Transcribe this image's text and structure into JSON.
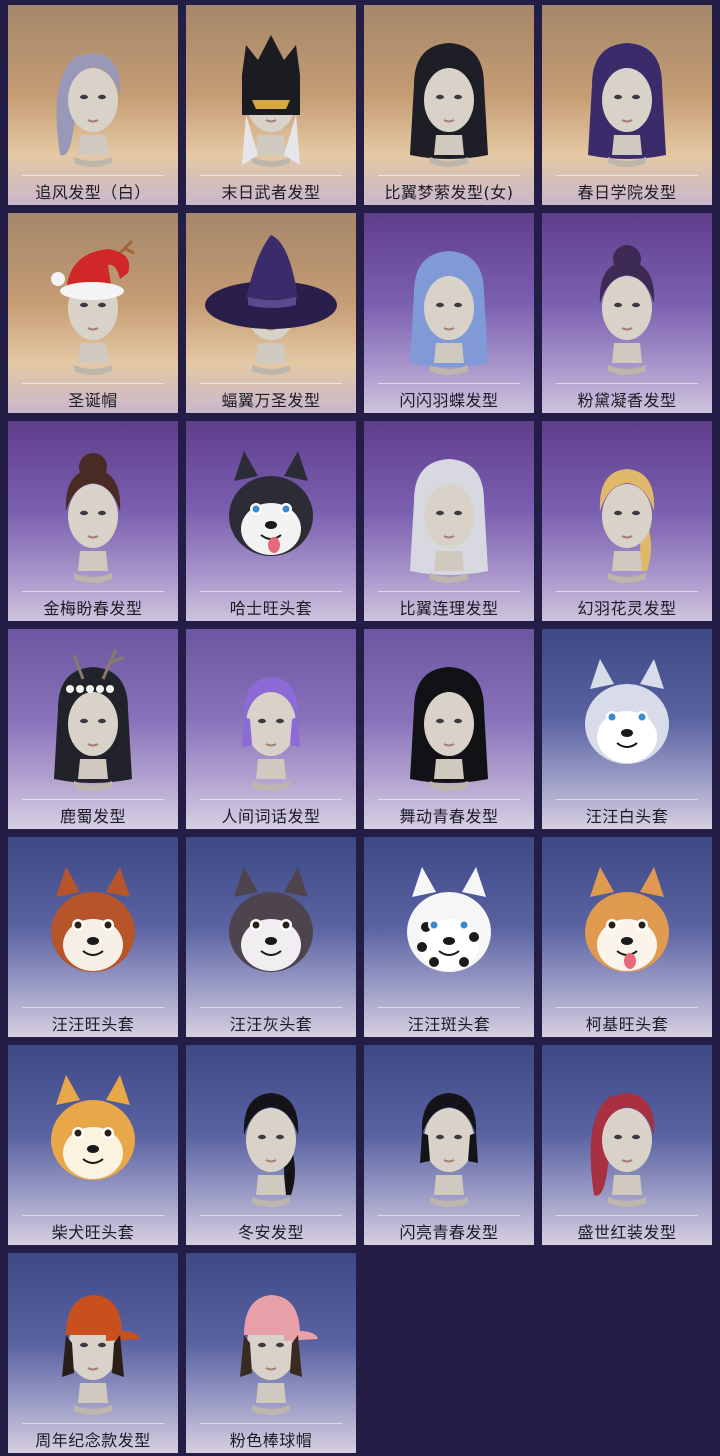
{
  "items": [
    {
      "label": "追风发型（白）",
      "icon": "silver-ponytail-hair-icon",
      "theme": "gold",
      "hair": "#9a98b8",
      "kind": "ponytail"
    },
    {
      "label": "末日武者发型",
      "icon": "armored-helmet-hair-icon",
      "theme": "gold",
      "hair": "#1b1b22",
      "kind": "helmet"
    },
    {
      "label": "比翼梦萦发型(女)",
      "icon": "black-long-hair-icon",
      "theme": "gold",
      "hair": "#1e1e26",
      "kind": "long"
    },
    {
      "label": "春日学院发型",
      "icon": "purple-long-hair-icon",
      "theme": "gold",
      "hair": "#3a2c6a",
      "kind": "long"
    },
    {
      "label": "圣诞帽",
      "icon": "santa-hat-icon",
      "theme": "gold",
      "hair": "#8a6a4a",
      "kind": "santa"
    },
    {
      "label": "蝠翼万圣发型",
      "icon": "witch-hat-icon",
      "theme": "gold",
      "hair": "#2a1f4a",
      "kind": "witch"
    },
    {
      "label": "闪闪羽蝶发型",
      "icon": "blue-wavy-hair-icon",
      "theme": "purple",
      "hair": "#7f9ad6",
      "kind": "long"
    },
    {
      "label": "粉黛凝香发型",
      "icon": "purple-bun-hair-icon",
      "theme": "purple",
      "hair": "#3d2a55",
      "kind": "bun"
    },
    {
      "label": "金梅盼春发型",
      "icon": "brown-bun-hair-icon",
      "theme": "purple",
      "hair": "#4a2a24",
      "kind": "bun"
    },
    {
      "label": "哈士旺头套",
      "icon": "husky-mask-icon",
      "theme": "purple",
      "hair": "#2a2a34",
      "kind": "dog",
      "dog": "husky"
    },
    {
      "label": "比翼连理发型",
      "icon": "silver-feather-hair-icon",
      "theme": "purple",
      "hair": "#d8d8e0",
      "kind": "long"
    },
    {
      "label": "幻羽花灵发型",
      "icon": "blonde-braid-hair-icon",
      "theme": "purple",
      "hair": "#e0b86a",
      "kind": "braid"
    },
    {
      "label": "鹿蜀发型",
      "icon": "deer-antler-hair-icon",
      "theme": "lav",
      "hair": "#22222a",
      "kind": "antler"
    },
    {
      "label": "人间词话发型",
      "icon": "violet-bob-hair-icon",
      "theme": "lav",
      "hair": "#8c6ad8",
      "kind": "bob"
    },
    {
      "label": "舞动青春发型",
      "icon": "black-straight-hair-icon",
      "theme": "lav",
      "hair": "#121216",
      "kind": "long"
    },
    {
      "label": "汪汪白头套",
      "icon": "white-dog-mask-icon",
      "theme": "blue",
      "hair": "#c0c4d8",
      "kind": "dog",
      "dog": "white"
    },
    {
      "label": "汪汪旺头套",
      "icon": "red-dog-mask-icon",
      "theme": "blue",
      "hair": "#b6542a",
      "kind": "dog",
      "dog": "red"
    },
    {
      "label": "汪汪灰头套",
      "icon": "gray-dog-mask-icon",
      "theme": "blue",
      "hair": "#5a4e5a",
      "kind": "dog",
      "dog": "gray"
    },
    {
      "label": "汪汪斑头套",
      "icon": "dalmatian-mask-icon",
      "theme": "blue",
      "hair": "#1a1a1a",
      "kind": "dog",
      "dog": "spot"
    },
    {
      "label": "柯基旺头套",
      "icon": "corgi-mask-icon",
      "theme": "blue",
      "hair": "#e09a50",
      "kind": "dog",
      "dog": "corgi"
    },
    {
      "label": "柴犬旺头套",
      "icon": "shiba-mask-icon",
      "theme": "blue",
      "hair": "#e8a84a",
      "kind": "dog",
      "dog": "shiba"
    },
    {
      "label": "冬安发型",
      "icon": "black-side-braid-hair-icon",
      "theme": "blue",
      "hair": "#141418",
      "kind": "braid"
    },
    {
      "label": "闪亮青春发型",
      "icon": "black-short-hair-icon",
      "theme": "blue",
      "hair": "#141418",
      "kind": "bob"
    },
    {
      "label": "盛世红装发型",
      "icon": "red-ponytail-hair-icon",
      "theme": "blue",
      "hair": "#a83040",
      "kind": "ponytail"
    },
    {
      "label": "周年纪念款发型",
      "icon": "orange-cap-hair-icon",
      "theme": "blue",
      "hair": "#2a1e18",
      "kind": "cap",
      "cap": "#c8501e"
    },
    {
      "label": "粉色棒球帽",
      "icon": "pink-cap-hair-icon",
      "theme": "blue",
      "hair": "#3a2a24",
      "kind": "cap",
      "cap": "#e8a0a8"
    }
  ]
}
